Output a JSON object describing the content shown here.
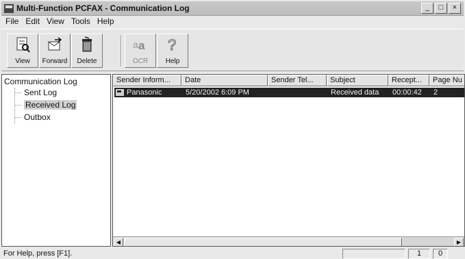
{
  "window": {
    "title": "Multi-Function PCFAX - Communication Log",
    "controls": [
      "_",
      "□",
      "×"
    ]
  },
  "menu": [
    "File",
    "Edit",
    "View",
    "Tools",
    "Help"
  ],
  "toolbar": {
    "buttons": [
      {
        "label": "View",
        "icon": "view-icon",
        "enabled": true
      },
      {
        "label": "Forward",
        "icon": "forward-icon",
        "enabled": true
      },
      {
        "label": "Delete",
        "icon": "trash-icon",
        "enabled": true
      },
      {
        "label": "OCR",
        "icon": "ocr-icon",
        "enabled": false
      },
      {
        "label": "Help",
        "icon": "help-icon",
        "enabled": true
      }
    ]
  },
  "tree": {
    "root": "Communication Log",
    "items": [
      {
        "label": "Sent Log",
        "selected": false
      },
      {
        "label": "Received Log",
        "selected": true
      },
      {
        "label": "Outbox",
        "selected": false
      }
    ]
  },
  "list": {
    "columns": [
      "Sender Inform...",
      "Date",
      "Sender Tel...",
      "Subject",
      "Recept...",
      "Page Nu"
    ],
    "rows": [
      {
        "sender": "Panasonic",
        "date": "5/20/2002 6:09 PM",
        "tel": "",
        "subject": "Received data",
        "reception": "00:00:42",
        "pages": "2"
      }
    ]
  },
  "status": {
    "help_text": "For Help, press [F1].",
    "count": "1",
    "value": "0"
  }
}
